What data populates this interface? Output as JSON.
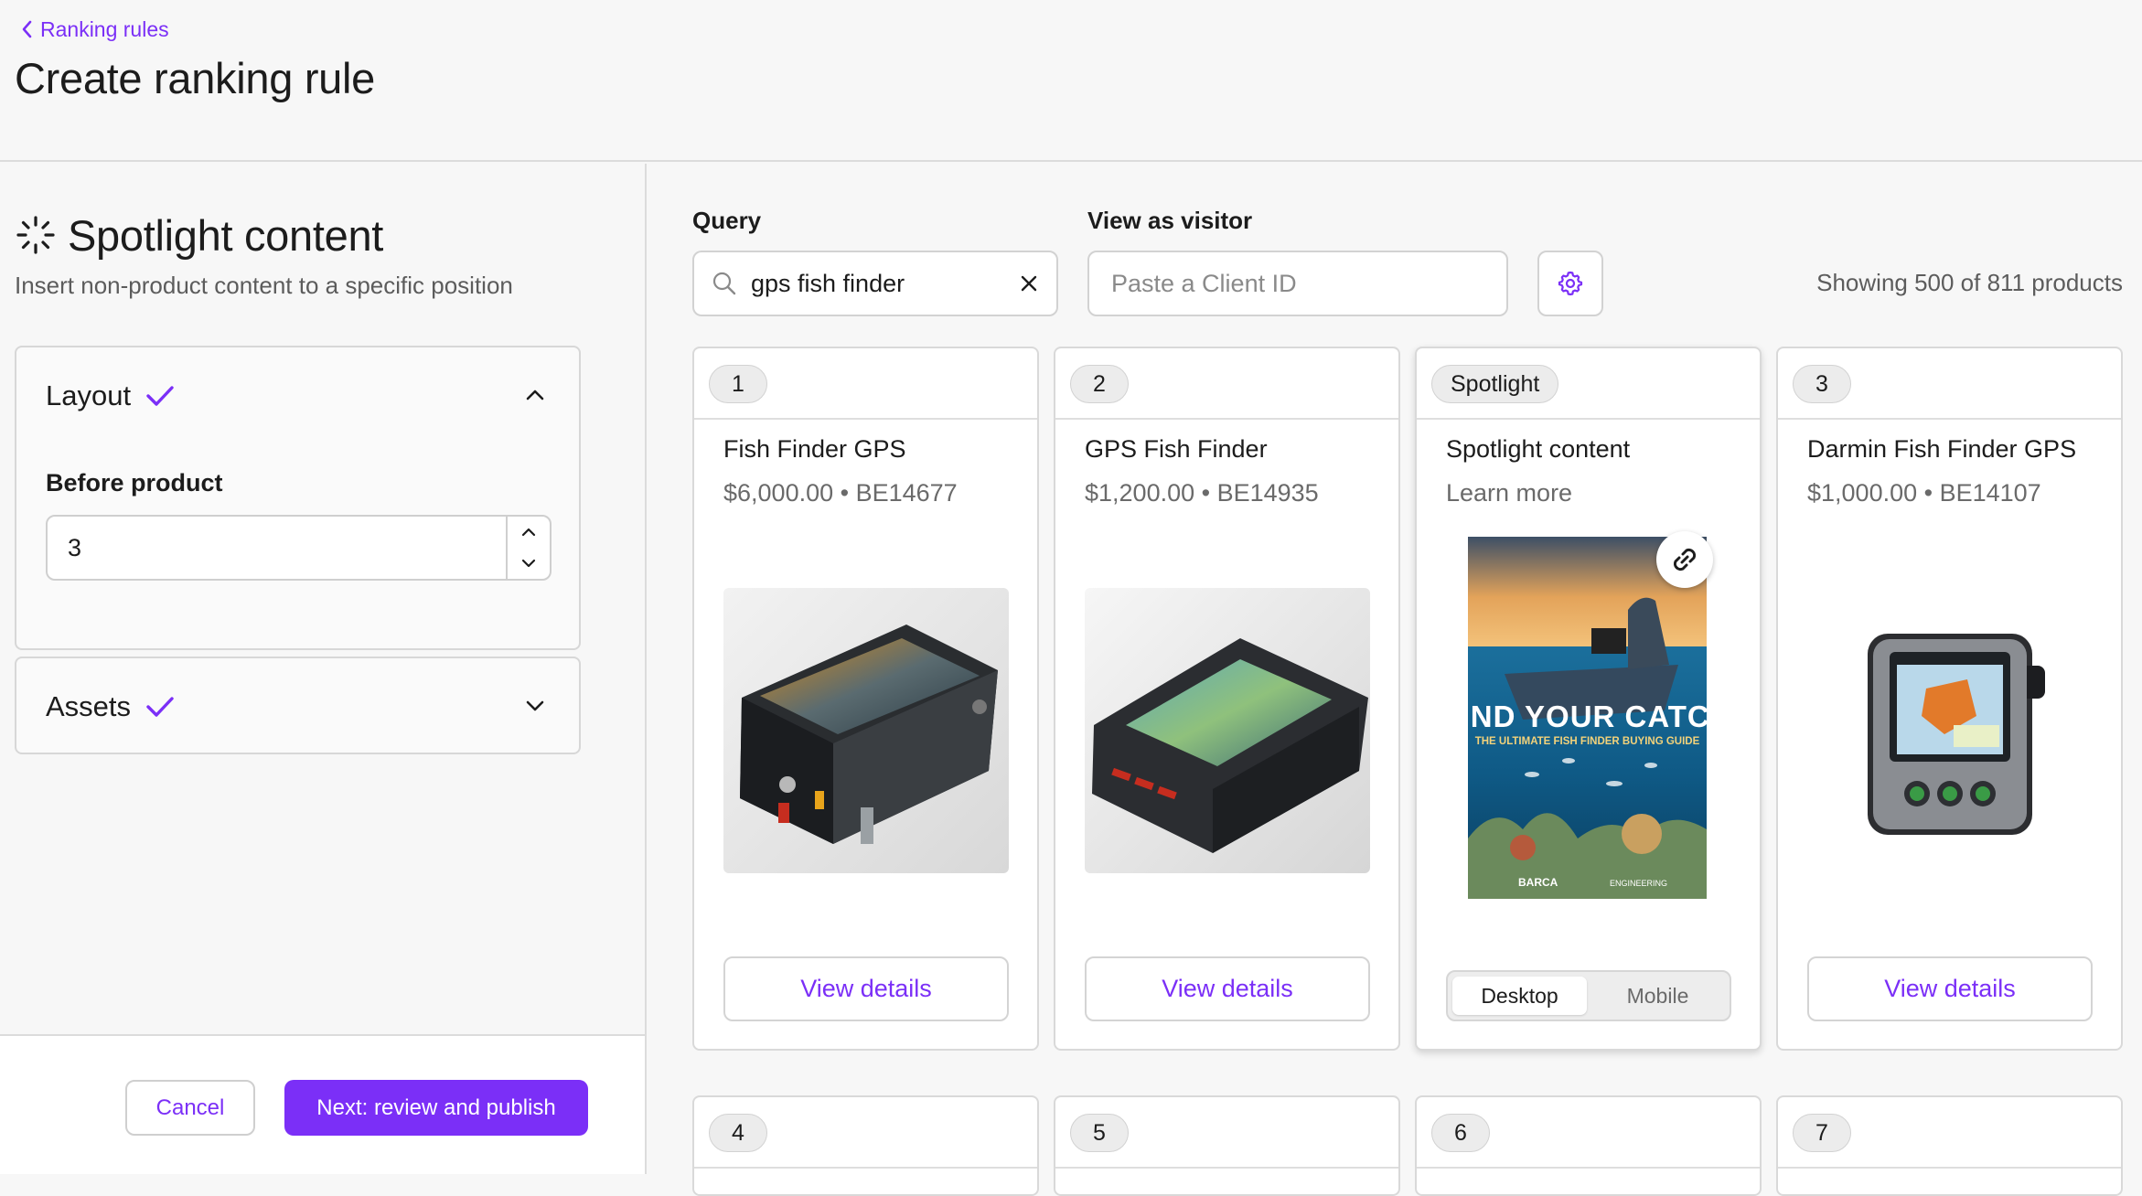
{
  "header": {
    "breadcrumb": "Ranking rules",
    "title": "Create ranking rule"
  },
  "left": {
    "section_title": "Spotlight content",
    "section_subtitle": "Insert non-product content to a specific position",
    "layout": {
      "title": "Layout",
      "field_label": "Before product",
      "field_value": "3"
    },
    "assets": {
      "title": "Assets"
    },
    "footer": {
      "cancel": "Cancel",
      "next": "Next: review and publish"
    }
  },
  "right": {
    "query_label": "Query",
    "query_value": "gps fish finder",
    "visitor_label": "View as visitor",
    "visitor_placeholder": "Paste a Client ID",
    "result_count": "Showing 500 of 811 products",
    "cards": [
      {
        "badge": "1",
        "title": "Fish Finder GPS",
        "meta": "$6,000.00 • BE14677",
        "button": "View details"
      },
      {
        "badge": "2",
        "title": "GPS Fish Finder",
        "meta": "$1,200.00 • BE14935",
        "button": "View details"
      },
      {
        "badge": "Spotlight",
        "title": "Spotlight content",
        "meta": "Learn more",
        "poster": {
          "headline": "FIND YOUR CATCH",
          "subhead": "THE ULTIMATE FISH FINDER BUYING GUIDE",
          "brand_left": "BARCA",
          "brand_right": "ENGINEERING"
        },
        "segment": [
          "Desktop",
          "Mobile"
        ],
        "segment_selected": "Desktop"
      },
      {
        "badge": "3",
        "title": "Darmin Fish Finder GPS",
        "meta": "$1,000.00 • BE14107",
        "button": "View details"
      }
    ],
    "next_row_badges": [
      "4",
      "5",
      "6",
      "7"
    ]
  },
  "colors": {
    "accent": "#7b2ff7",
    "border": "#d9d9d9",
    "background": "#f7f7f7"
  }
}
